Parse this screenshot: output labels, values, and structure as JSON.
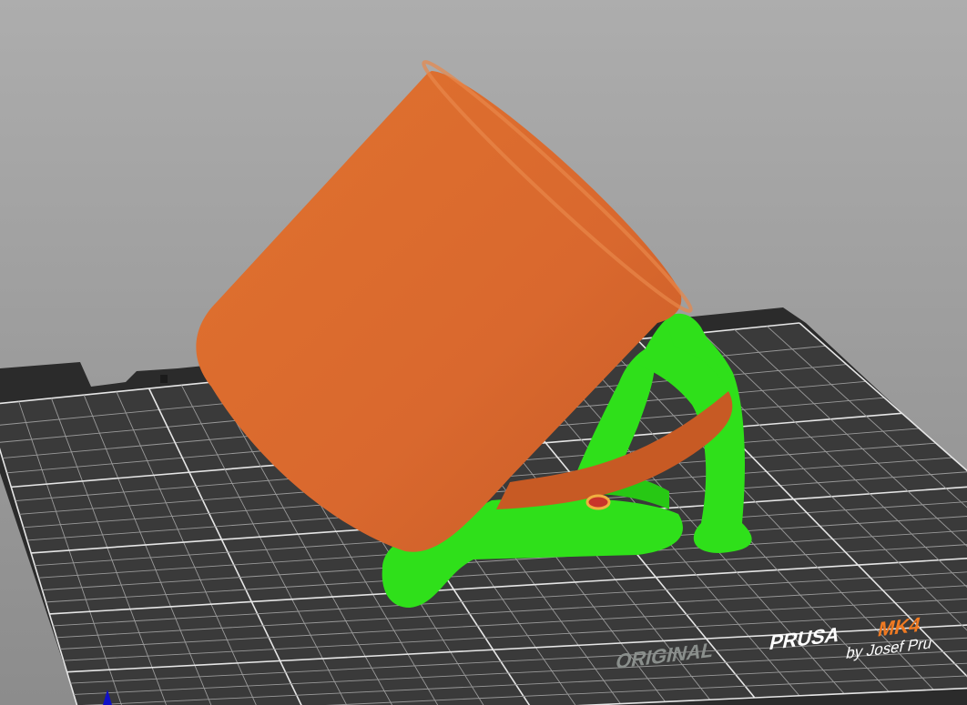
{
  "viewport": {
    "background_top": "#a9a9a9",
    "background_bottom": "#8a8a8a",
    "bed_color": "#2b2b2b",
    "bed_surface_color": "#3a3a3a",
    "model_color": "#d9682e",
    "support_color": "#2fe01a",
    "grid_divisions": 25
  },
  "bed_logo": {
    "original": "ORIGINAL",
    "prusa": "PRUSA",
    "model": "MK4",
    "by": "by Josef Pru",
    "accent_color": "#f07a22"
  }
}
